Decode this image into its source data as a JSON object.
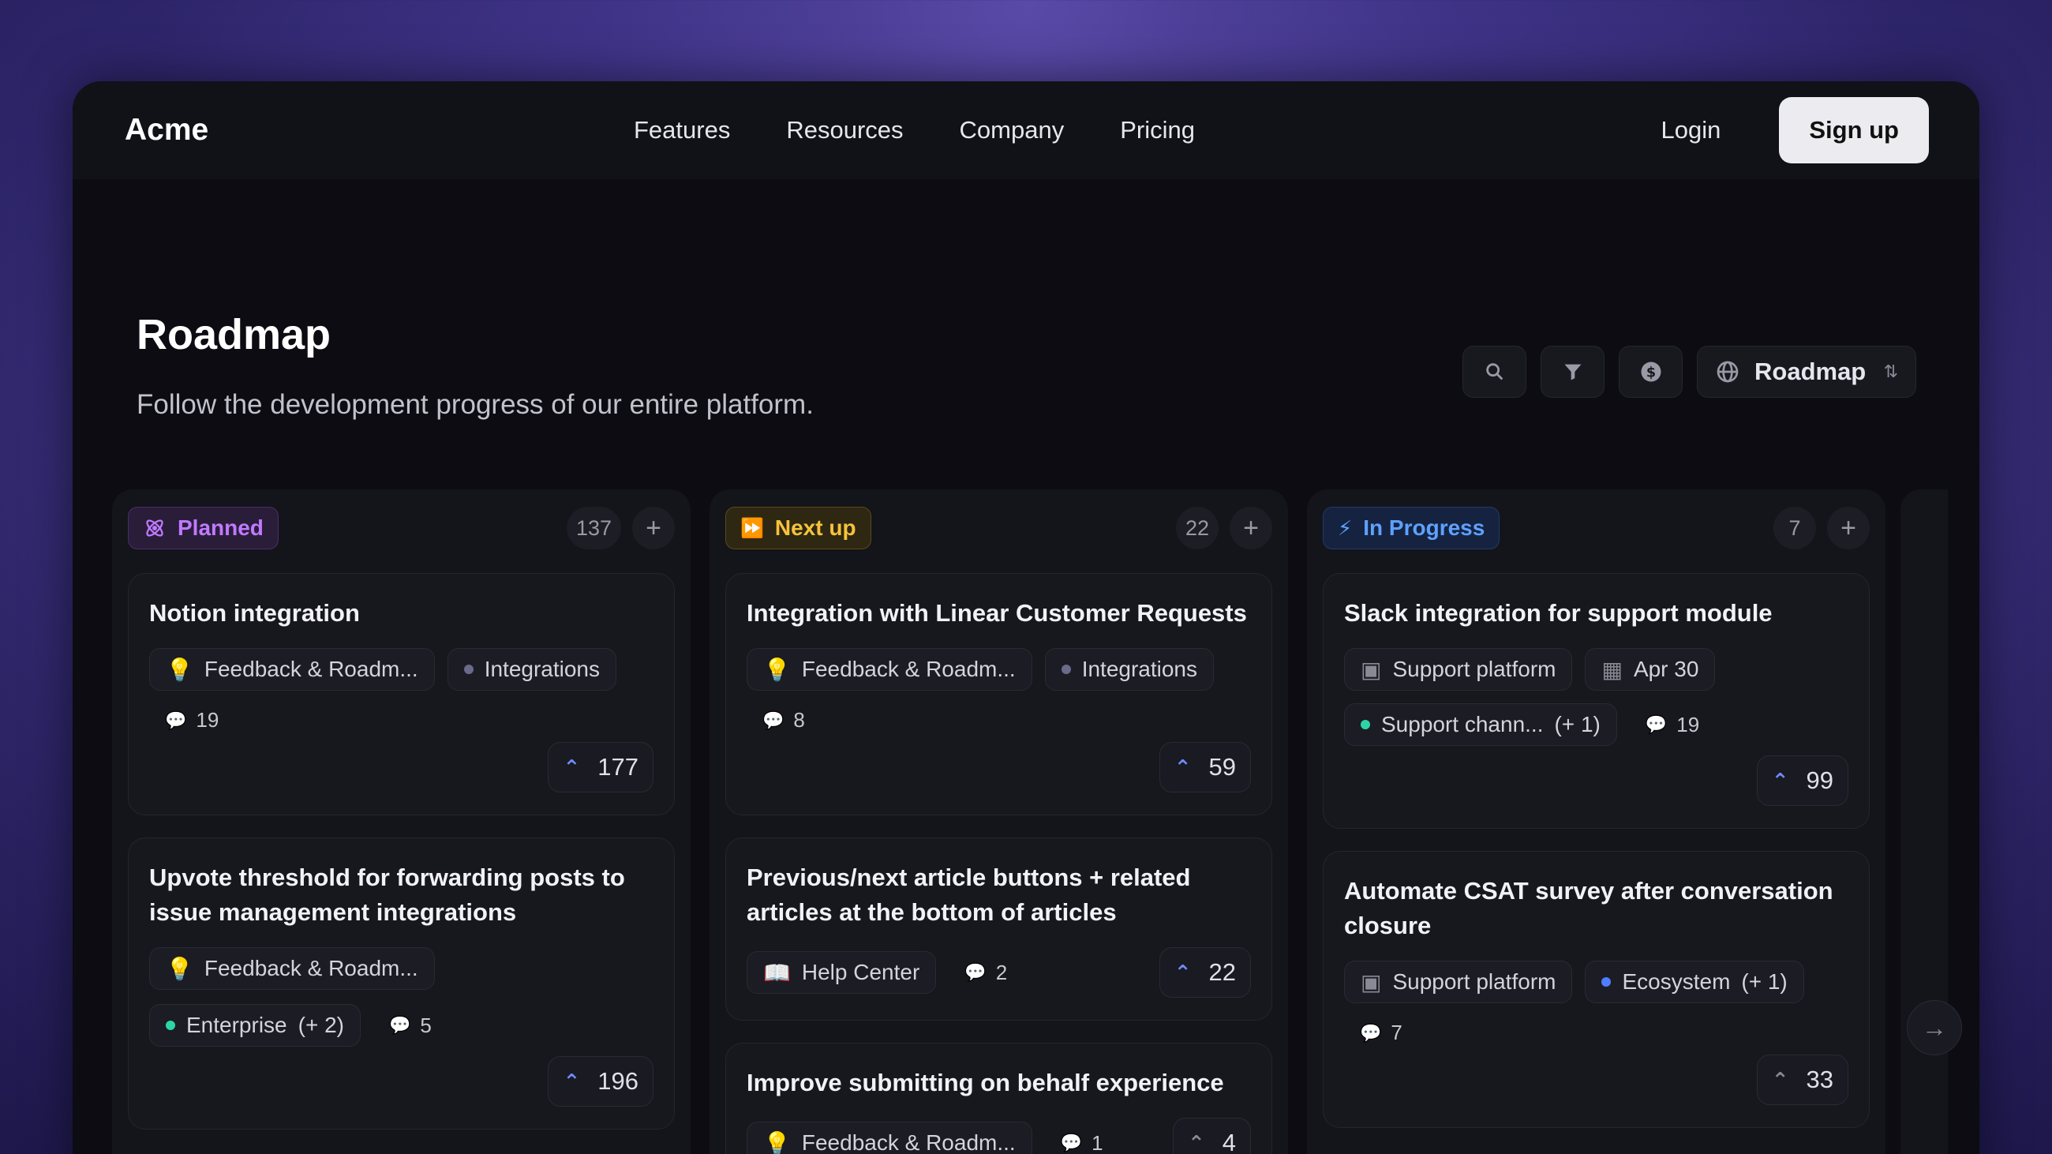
{
  "brand": "Acme",
  "nav": [
    "Features",
    "Resources",
    "Company",
    "Pricing"
  ],
  "auth": {
    "login": "Login",
    "signup": "Sign up"
  },
  "hero": {
    "title": "Roadmap",
    "subtitle": "Follow the development progress of our entire platform."
  },
  "toolbar": {
    "view_select": "Roadmap",
    "icons": [
      "search-icon",
      "filter-icon",
      "dollar-icon",
      "globe-icon"
    ]
  },
  "columns": [
    {
      "label": "Planned",
      "count": "137",
      "color": "#c07aff",
      "cards": [
        {
          "title": "Notion integration",
          "tags": [
            "Feedback & Roadm...",
            "Integrations"
          ],
          "comments": "19",
          "votes": "177"
        },
        {
          "title": "Upvote threshold for forwarding posts to issue management integrations",
          "tags": [
            "Feedback & Roadm...",
            "Enterprise",
            "(+ 2)"
          ],
          "comments": "5",
          "votes": "196"
        }
      ]
    },
    {
      "label": "Next up",
      "count": "22",
      "color": "#f5c33b",
      "cards": [
        {
          "title": "Integration with Linear Customer Requests",
          "tags": [
            "Feedback & Roadm...",
            "Integrations"
          ],
          "comments": "8",
          "votes": "59"
        },
        {
          "title": "Previous/next article buttons + related articles at the bottom of articles",
          "tags": [
            "Help Center"
          ],
          "comments": "2",
          "votes": "22"
        },
        {
          "title": "Improve submitting on behalf experience",
          "tags": [
            "Feedback & Roadm..."
          ],
          "comments": "1",
          "votes": "4"
        }
      ]
    },
    {
      "label": "In Progress",
      "count": "7",
      "color": "#5ea1ff",
      "cards": [
        {
          "title": "Slack integration for support module",
          "tags": [
            "Support platform",
            "Apr 30",
            "Support chann...",
            "(+ 1)"
          ],
          "comments": "19",
          "votes": "99"
        },
        {
          "title": "Automate CSAT survey after conversation closure",
          "tags": [
            "Support platform",
            "Ecosystem",
            "(+ 1)"
          ],
          "comments": "7",
          "votes": "33"
        }
      ]
    }
  ]
}
